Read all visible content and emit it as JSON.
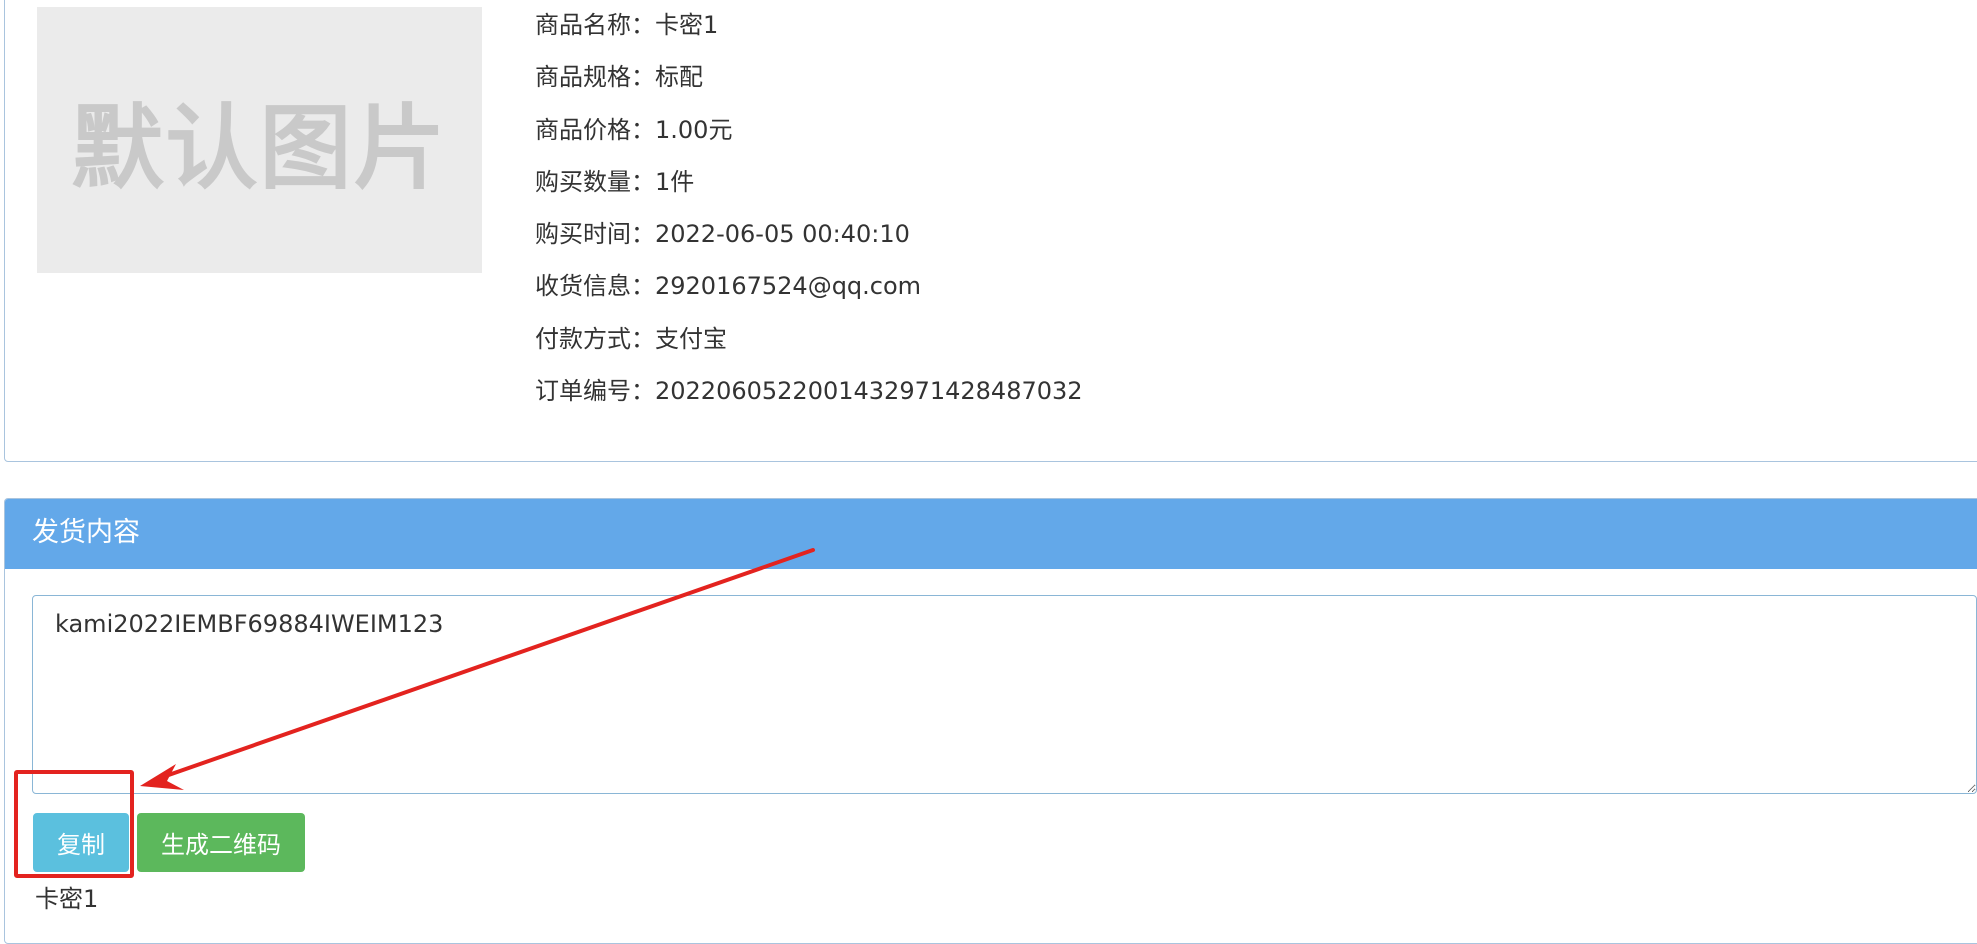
{
  "order_info": {
    "image_placeholder_text": "默认图片",
    "rows": [
      {
        "label": "商品名称：",
        "value": "卡密1"
      },
      {
        "label": "商品规格：",
        "value": "标配"
      },
      {
        "label": "商品价格：",
        "value": "1.00元"
      },
      {
        "label": "购买数量：",
        "value": "1件"
      },
      {
        "label": "购买时间：",
        "value": "2022-06-05 00:40:10"
      },
      {
        "label": "收货信息：",
        "value": "2920167524@qq.com"
      },
      {
        "label": "付款方式：",
        "value": "支付宝"
      },
      {
        "label": "订单编号：",
        "value": "2022060522001432971428487032"
      }
    ]
  },
  "delivery": {
    "title": "发货内容",
    "content": "kami2022IEMBF69884IWEIM123",
    "copy_button": "复制",
    "qrcode_button": "生成二维码",
    "footer_text": "卡密1"
  },
  "colors": {
    "header_blue": "#63a8e9",
    "copy_button": "#5bc0de",
    "qrcode_button": "#5cb85c",
    "annotation_red": "#e3231f"
  }
}
